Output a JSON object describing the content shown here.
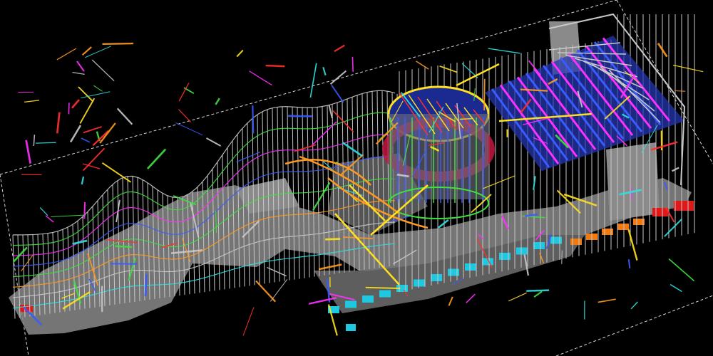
{
  "viewport": {
    "background": "#000000",
    "view": "isometric-3d-wireframe"
  },
  "colors": {
    "frame_grey": "#c8c8c8",
    "slab_grey": "#8a8a8a",
    "slab_dark": "#5e5e5e",
    "foundation_cyan": "#1ec8e0",
    "foundation_orange": "#f07a10",
    "foundation_red": "#e01818",
    "member_magenta": "#ff30ff",
    "member_blue": "#3a5cff",
    "member_green": "#40e040",
    "member_yellow": "#ffe020",
    "member_red": "#ff3030",
    "member_cyan": "#30e0e0",
    "member_orange": "#ff9a20",
    "drum_red": "#c01840",
    "guide_white": "#ffffff"
  },
  "icons": {
    "model": "structural-steel-model-icon"
  }
}
